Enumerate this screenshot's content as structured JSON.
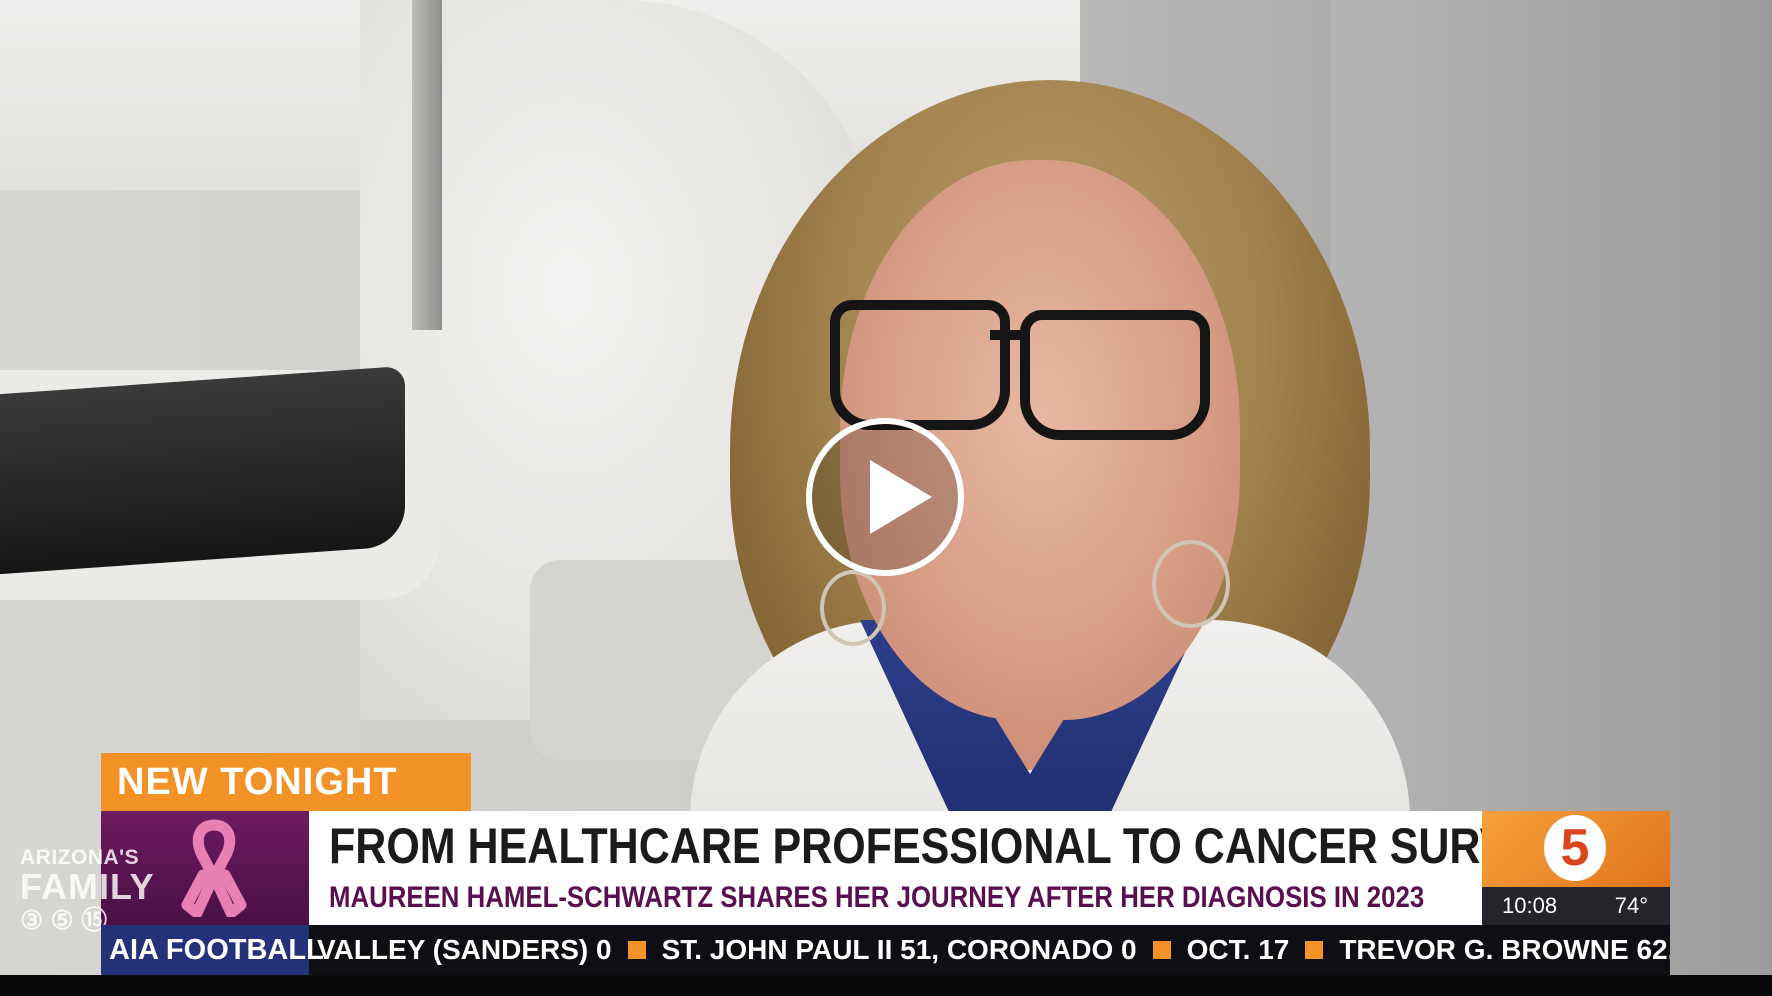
{
  "video": {
    "play_icon": "play-icon"
  },
  "lower_third": {
    "badge": "NEW TONIGHT",
    "headline": "FROM HEALTHCARE PROFESSIONAL TO CANCER SURVIVOR",
    "subline": "MAUREEN HAMEL-SCHWARTZ SHARES HER JOURNEY AFTER HER DIAGNOSIS IN 2023",
    "ribbon_icon": "pink-ribbon-icon",
    "ribbon_color": "#e87fb5",
    "station_logo": "5",
    "time": "10:08",
    "temperature": "74°"
  },
  "watermark": {
    "line1": "ARIZONA'S",
    "line2": "FAMILY",
    "logos": "③ ⑤ ⑮"
  },
  "ticker": {
    "label": "AIA FOOTBALL",
    "items": [
      "VALLEY (SANDERS) 0",
      "ST. JOHN PAUL II 51, CORONADO 0",
      "OCT. 17",
      "TREVOR G. BROWNE 62,"
    ]
  },
  "colors": {
    "badge_orange": "#f39227",
    "ticker_label_blue": "#24327a",
    "subline_purple": "#5a1050"
  }
}
